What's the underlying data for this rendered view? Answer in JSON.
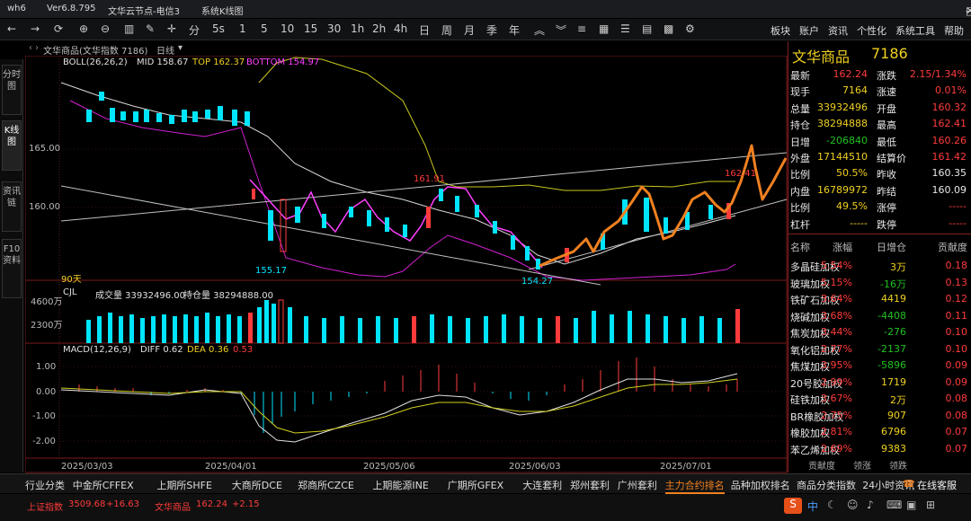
{
  "titlebar": {
    "app": "wh6",
    "version": "Ver6.8.795",
    "server": "文华云节点-电信3",
    "chart_name": "系统K线图",
    "controls": [
      "—",
      "□",
      "✕"
    ]
  },
  "toolbar": {
    "periods": [
      "分",
      "5s",
      "1",
      "5",
      "10",
      "15",
      "30",
      "1h",
      "2h",
      "4h",
      "日",
      "周",
      "月",
      "季",
      "年"
    ],
    "right_menu": [
      "板块",
      "账户",
      "资讯",
      "个性化",
      "系统工具",
      "帮助"
    ]
  },
  "side_tabs": [
    "分时图",
    "K线图",
    "资讯链",
    "F10资料"
  ],
  "chart_header": {
    "title": "文华商品(文华指数 7186)",
    "period": "日线"
  },
  "boll": {
    "label": "BOLL(26,26,2)",
    "mid": "MID 158.67",
    "top": "TOP 162.37",
    "bottom": "BOTTOM 154.97"
  },
  "price_labels": {
    "p165": "165.00",
    "p160": "160.00",
    "hi1": "161.91",
    "lo1": "155.17",
    "lo2": "154.27",
    "last": "162.41",
    "days": "90天"
  },
  "cjl": {
    "label": "CJL",
    "volume": "成交量 33932496.00",
    "oi": "持仓量 38294888.00",
    "v1": "4600万",
    "v2": "2300万"
  },
  "macd": {
    "label": "MACD(12,26,9)",
    "diff": "DIFF 0.62",
    "dea": "DEA 0.36",
    "macd": "0.53",
    "ticks": [
      "1.00",
      "0.00",
      "-1.00",
      "-2.00"
    ]
  },
  "dates": [
    "2025/03/03",
    "2025/04/01",
    "2025/05/06",
    "2025/06/03",
    "2025/07/01"
  ],
  "quote": {
    "name": "文华商品",
    "code": "7186",
    "rows": [
      [
        "最新",
        "162.24",
        "涨跌",
        "2.15/1.34%"
      ],
      [
        "现手",
        "7164",
        "涨速",
        "0.01%"
      ],
      [
        "总量",
        "33932496",
        "开盘",
        "160.32"
      ],
      [
        "持仓",
        "38294888",
        "最高",
        "162.41"
      ],
      [
        "日增",
        "-206840",
        "最低",
        "160.26"
      ],
      [
        "外盘",
        "17144510",
        "结算价",
        "161.42"
      ],
      [
        "比例",
        "50.5%",
        "昨收",
        "160.35"
      ],
      [
        "内盘",
        "16789972",
        "昨结",
        "160.09"
      ],
      [
        "比例",
        "49.5%",
        "涨停",
        "-----"
      ],
      [
        "杠杆",
        "-----",
        "跌停",
        "-----"
      ]
    ]
  },
  "rank": {
    "headers": [
      "名称",
      "涨幅",
      "日增仓",
      "贡献度"
    ],
    "rows": [
      [
        "多晶硅加权",
        "5.54%",
        "3万",
        "0.18"
      ],
      [
        "玻璃加权",
        "5.15%",
        "-16万",
        "0.13"
      ],
      [
        "铁矿石加权",
        "3.64%",
        "4419",
        "0.12"
      ],
      [
        "烧碱加权",
        "3.68%",
        "-4408",
        "0.11"
      ],
      [
        "焦炭加权",
        "3.44%",
        "-276",
        "0.10"
      ],
      [
        "氧化铝加权",
        "2.77%",
        "-2137",
        "0.10"
      ],
      [
        "焦煤加权",
        "3.95%",
        "-5896",
        "0.09"
      ],
      [
        "20号胶加权",
        "2.99%",
        "1719",
        "0.09"
      ],
      [
        "硅铁加权",
        "3.67%",
        "2万",
        "0.08"
      ],
      [
        "BR橡胶加权",
        "2.75%",
        "907",
        "0.08"
      ],
      [
        "橡胶加权",
        "2.81%",
        "6796",
        "0.07"
      ],
      [
        "苯乙烯加权",
        "2.69%",
        "9383",
        "0.07"
      ]
    ],
    "tabs": [
      "贡献度",
      "领涨",
      "领跌"
    ]
  },
  "bottom_tabs": [
    "行业分类",
    "中金所CFFEX",
    "上期所SHFE",
    "大商所DCE",
    "郑商所CZCE",
    "上期能源INE",
    "广期所GFEX",
    "大连套利",
    "郑州套利",
    "广州套利",
    "主力合约排名",
    "品种加权排名",
    "商品分类指数",
    "24小时资讯"
  ],
  "service": "在线客服",
  "status": {
    "idx1_name": "上证指数",
    "idx1_val": "3509.68",
    "idx1_chg": "+16.63",
    "idx2_name": "文华商品",
    "idx2_val": "162.24",
    "idx2_chg": "+2.15",
    "ime": "中"
  },
  "colors": {
    "up": "#ff3b3b",
    "down": "#00e5ff",
    "annotation": "#f08020",
    "boll_mid": "#e0e0e0",
    "boll_band": "#d0d020",
    "ma": "#ff40ff"
  }
}
